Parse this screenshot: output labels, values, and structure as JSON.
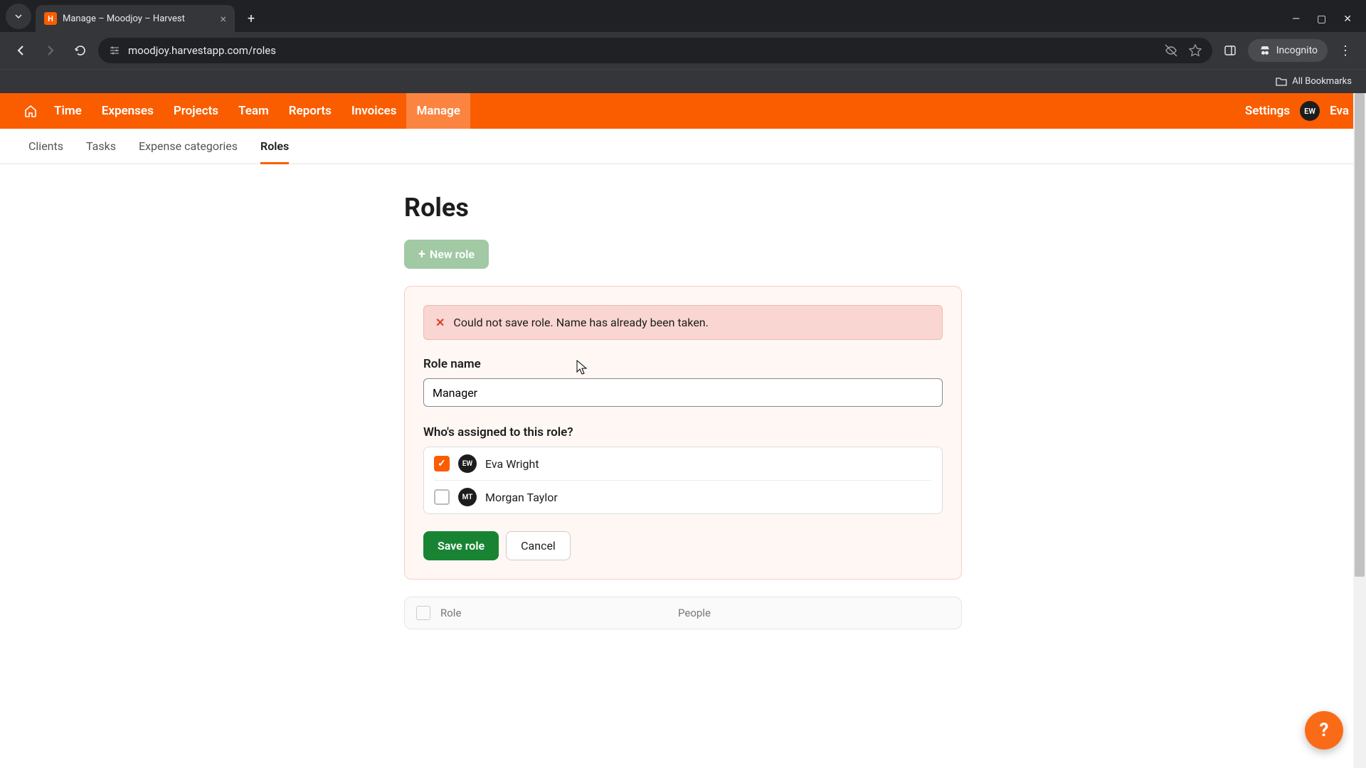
{
  "browser": {
    "tab_title": "Manage – Moodjoy – Harvest",
    "url": "moodjoy.harvestapp.com/roles",
    "incognito_label": "Incognito",
    "bookmarks_label": "All Bookmarks"
  },
  "header": {
    "nav": [
      "Time",
      "Expenses",
      "Projects",
      "Team",
      "Reports",
      "Invoices",
      "Manage"
    ],
    "active_nav": "Manage",
    "settings_label": "Settings",
    "user_initials": "EW",
    "user_name": "Eva"
  },
  "subnav": {
    "items": [
      "Clients",
      "Tasks",
      "Expense categories",
      "Roles"
    ],
    "active": "Roles"
  },
  "page": {
    "title": "Roles",
    "new_role_label": "New role"
  },
  "form": {
    "error_message": "Could not save role. Name has already been taken.",
    "role_name_label": "Role name",
    "role_name_value": "Manager",
    "assign_label": "Who's assigned to this role?",
    "assignees": [
      {
        "initials": "EW",
        "name": "Eva Wright",
        "checked": true
      },
      {
        "initials": "MT",
        "name": "Morgan Taylor",
        "checked": false
      }
    ],
    "save_label": "Save role",
    "cancel_label": "Cancel"
  },
  "table": {
    "col_role": "Role",
    "col_people": "People"
  },
  "help": {
    "label": "?"
  }
}
